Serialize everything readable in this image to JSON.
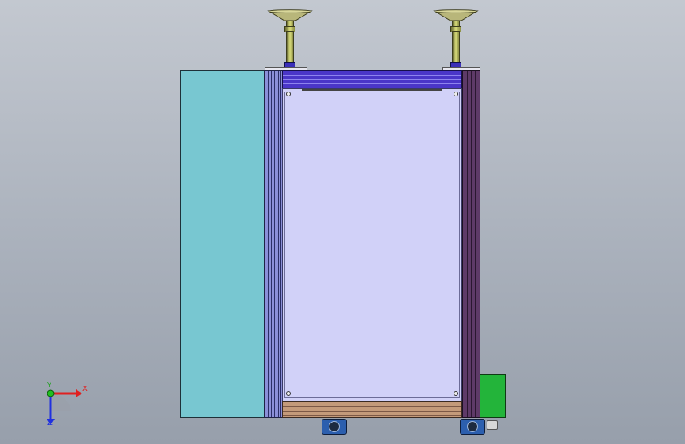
{
  "viewport": {
    "background": "#b0b6c0"
  },
  "axis_triad": {
    "x_label": "X",
    "y_label": "Y",
    "z_label": "Z",
    "x_color": "#e02020",
    "y_color": "#20c020",
    "z_color": "#2030e0"
  },
  "colors": {
    "side_panel": "#78c7d1",
    "door": "#d1d1f8",
    "top_bar": "#4a36c8",
    "right_frame": "#5e3a68",
    "base": "#c49a7a",
    "green_box": "#23b43a",
    "caster": "#2c5fae",
    "post": "#cfd26e"
  },
  "icons": [
    "suction-cup-icon",
    "caster-wheel-icon",
    "axis-triad-icon"
  ]
}
